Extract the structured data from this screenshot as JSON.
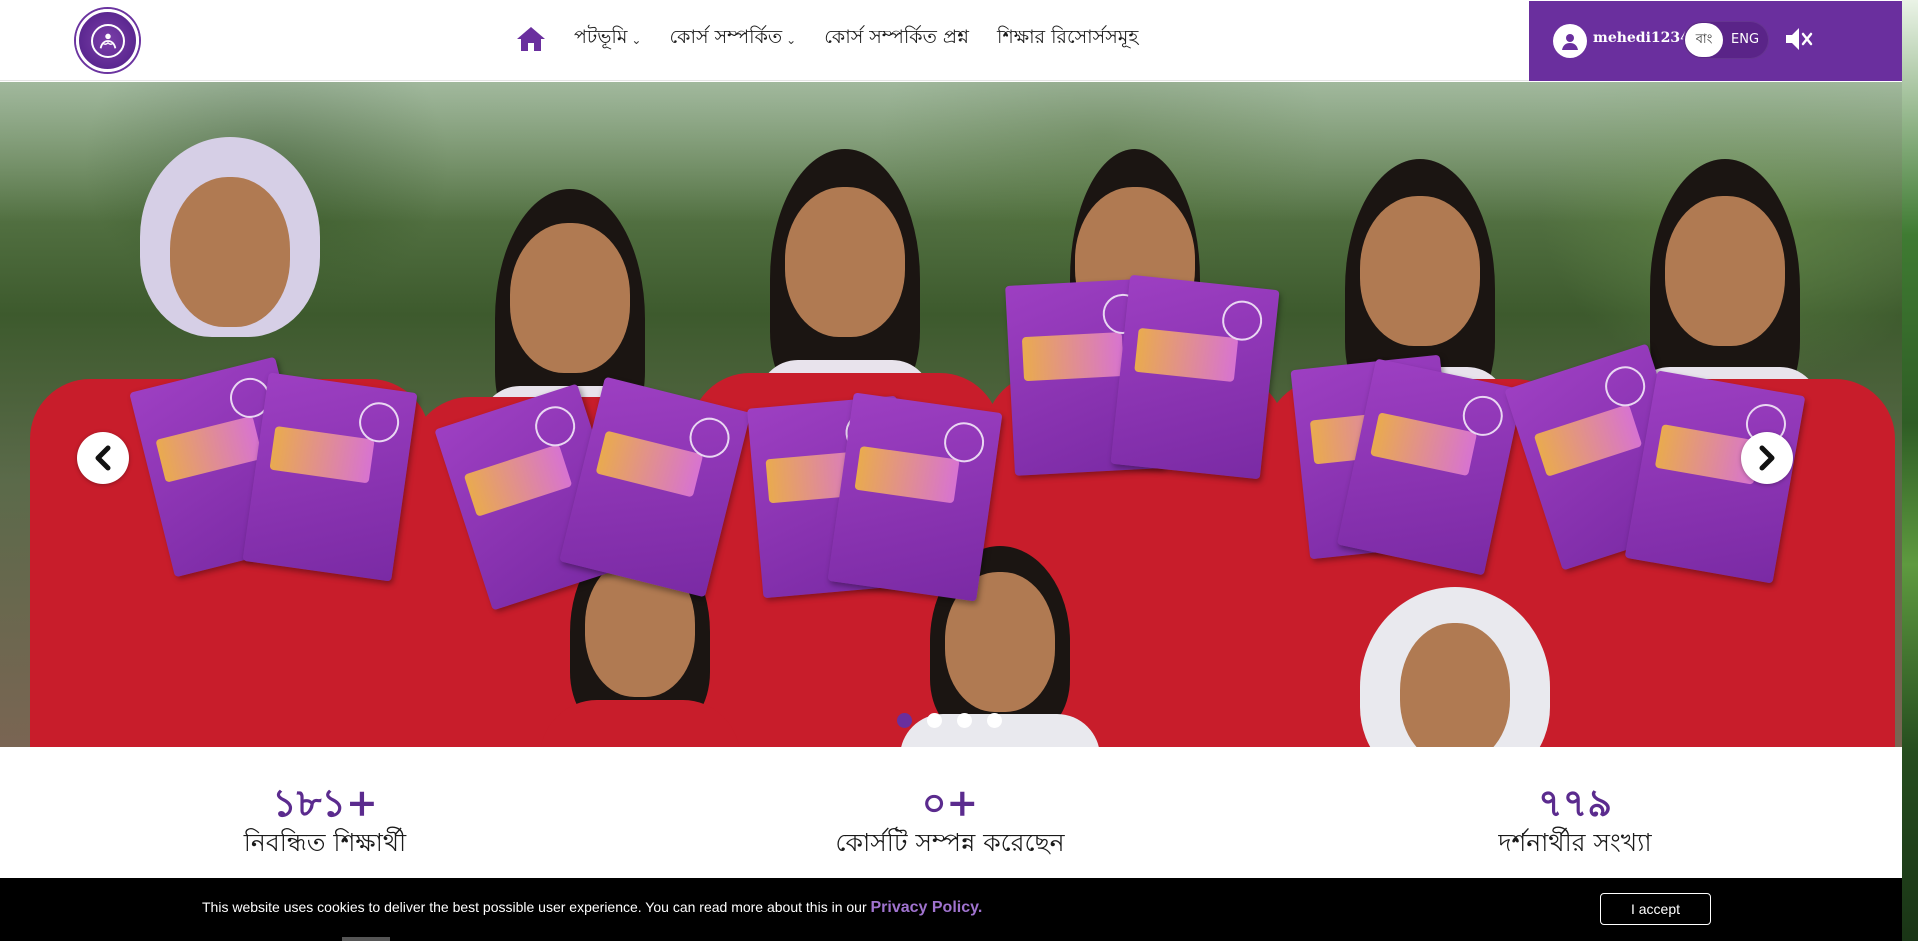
{
  "brand": {
    "logo_icon": "nutrition-challenge-badge-logo",
    "colors": {
      "primary": "#6a2f9e",
      "stat_number": "#5b2b8e"
    }
  },
  "nav": {
    "home_icon": "home-icon",
    "items": [
      {
        "label": "পটভূমি",
        "has_dropdown": true
      },
      {
        "label": "কোর্স সম্পর্কিত",
        "has_dropdown": true
      },
      {
        "label": "কোর্স সম্পর্কিত প্রশ্ন",
        "has_dropdown": false
      },
      {
        "label": "শিক্ষার রিসোর্সসমূহ",
        "has_dropdown": false
      }
    ]
  },
  "user": {
    "name": "mehedi1234",
    "lang_bn": "বাং",
    "lang_en": "ENG",
    "sound_icon": "speaker-mute-icon"
  },
  "hero": {
    "slide_count": 4,
    "active_slide": 1,
    "image_alt": "Schoolgirls holding Nutrition Challenge Badge books"
  },
  "stats": [
    {
      "number": "১৮১+",
      "label": "নিবন্ধিত শিক্ষার্থী"
    },
    {
      "number": "০+",
      "label": "কোর্সটি সম্পন্ন করেছেন"
    },
    {
      "number": "৭৭৯",
      "label": "দর্শনার্থীর সংখ্যা"
    }
  ],
  "cookie": {
    "text": "This website uses cookies to deliver the best possible user experience. You can read more about this in our ",
    "link": "Privacy Policy.",
    "accept": "I accept"
  }
}
